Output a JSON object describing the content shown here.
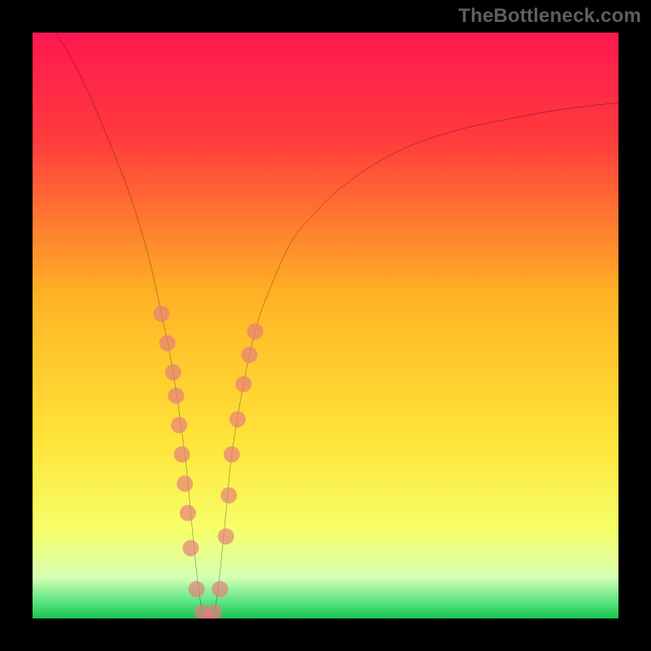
{
  "watermark": "TheBottleneck.com",
  "chart_data": {
    "type": "line",
    "title": "",
    "xlabel": "",
    "ylabel": "",
    "xlim": [
      0,
      100
    ],
    "ylim": [
      0,
      100
    ],
    "series": [
      {
        "name": "bottleneck-curve",
        "x": [
          4,
          8,
          12,
          16,
          18,
          20,
          22,
          24,
          26,
          27,
          28,
          29,
          30,
          31,
          32,
          33,
          34,
          36,
          38,
          40,
          44,
          48,
          52,
          56,
          60,
          64,
          68,
          72,
          76,
          80,
          84,
          88,
          92,
          96,
          100
        ],
        "y": [
          100,
          93,
          84,
          74,
          68,
          61,
          52,
          42,
          28,
          18,
          8,
          1,
          0,
          1,
          8,
          18,
          28,
          40,
          49,
          55,
          64,
          69,
          73,
          76,
          78.5,
          80.5,
          82,
          83.2,
          84.2,
          85,
          85.8,
          86.5,
          87.1,
          87.6,
          88
        ]
      }
    ],
    "scatter": {
      "name": "marker-points",
      "x": [
        22,
        23,
        24,
        24.5,
        25,
        25.5,
        26,
        26.5,
        27,
        28,
        29,
        30,
        31,
        32,
        33,
        33.5,
        34,
        35,
        36,
        37,
        38
      ],
      "y": [
        52,
        47,
        42,
        38,
        33,
        28,
        23,
        18,
        12,
        5,
        1,
        0,
        1,
        5,
        14,
        21,
        28,
        34,
        40,
        45,
        49
      ]
    },
    "gradient_stops": [
      {
        "pct": 0,
        "color": "#ff1850"
      },
      {
        "pct": 18,
        "color": "#ff3a3d"
      },
      {
        "pct": 45,
        "color": "#ffb324"
      },
      {
        "pct": 70,
        "color": "#ffe53a"
      },
      {
        "pct": 85,
        "color": "#f6ff6a"
      },
      {
        "pct": 93,
        "color": "#d6ffb4"
      },
      {
        "pct": 97,
        "color": "#5fe686"
      },
      {
        "pct": 100,
        "color": "#17c24f"
      }
    ]
  }
}
